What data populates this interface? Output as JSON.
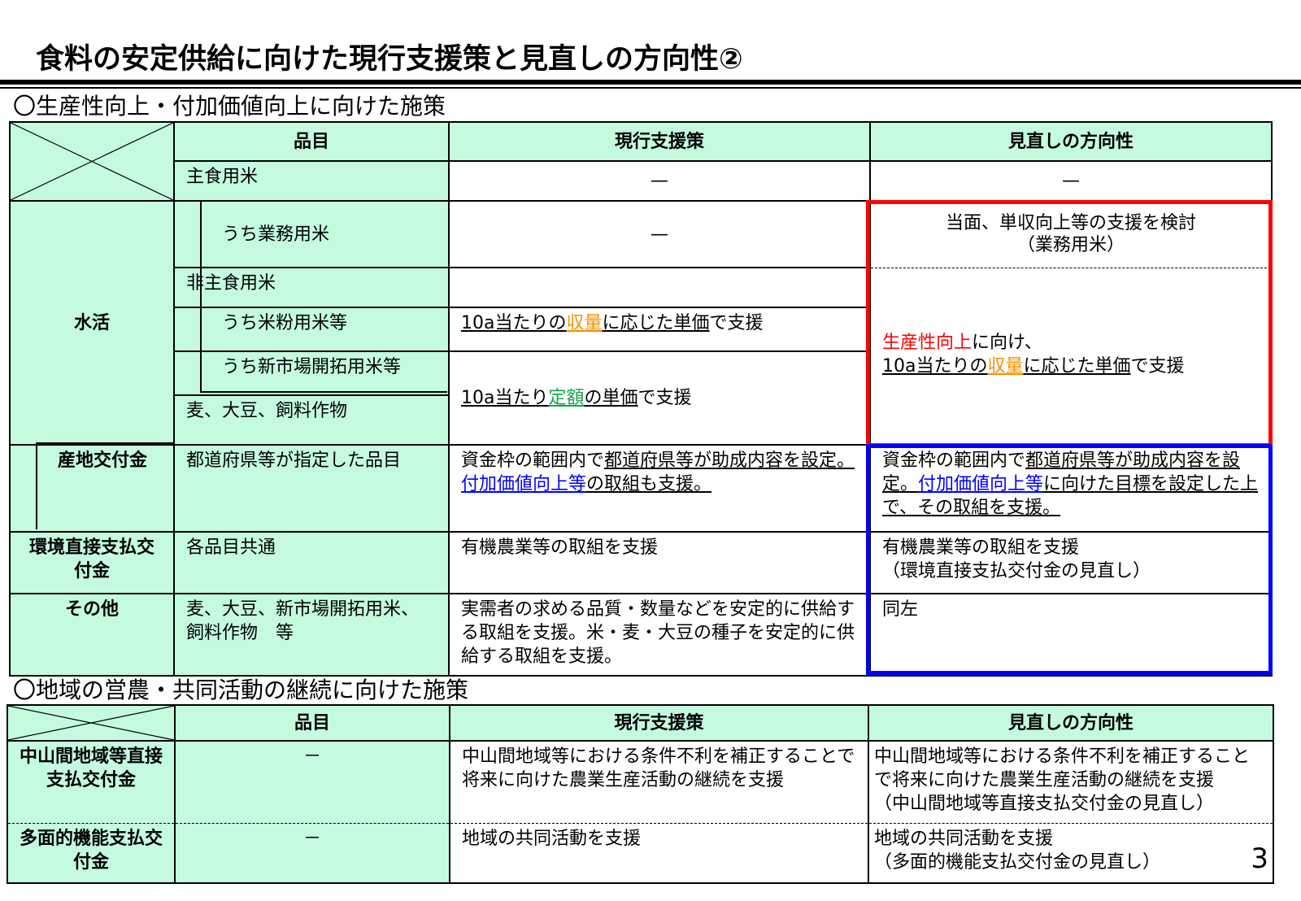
{
  "title": "食料の安定供給に向けた現行支援策と見直しの方向性②",
  "section1": {
    "heading": "〇生産性向上・付加価値向上に向けた施策",
    "col_item": "品目",
    "col_current": "現行支援策",
    "col_review": "見直しの方向性",
    "cat_suikatsu": "水活",
    "cat_sanchi": "産地交付金",
    "cat_kankyo": "環境直接支払交付金",
    "cat_sonota": "その他",
    "row_shushoku": {
      "item": "主食用米",
      "current": "—",
      "review": "—"
    },
    "row_gyomu": {
      "item": "うち業務用米",
      "current": "—",
      "review_1": "当面、単収向上等の支援を検討",
      "review_2": "（業務用米）"
    },
    "row_hishushoku": {
      "item": "非主食用米"
    },
    "row_komeko": {
      "item": "うち米粉用米等",
      "current_a": "10a当たりの",
      "current_b": "収量",
      "current_c": "に応じた単価",
      "current_d": "で支援"
    },
    "row_shinshijo": {
      "item": "うち新市場開拓用米等"
    },
    "row_mugi": {
      "item": "麦、大豆、飼料作物",
      "current_a": "10a当たり",
      "current_b": "定額",
      "current_c": "の単価",
      "current_d": "で支援"
    },
    "review_productivity": {
      "a": "生産性向上",
      "b": "に向け、",
      "c": "10a当たりの",
      "d": "収量",
      "e": "に応じた単価",
      "f": "で支援"
    },
    "row_sanchi": {
      "item": "都道府県等が指定した品目",
      "current_a": "資金枠の範囲内で",
      "current_b": "都道府県等が助成内容を設定。",
      "current_c": "付加価値向上等",
      "current_d": "の取組も支援。",
      "review_a": "資金枠の範囲内で",
      "review_b": "都道府県等が助成内容を設定。",
      "review_c": "付加価値向上等",
      "review_d": "に向けた目標を設定した上で、その取組を支援。"
    },
    "row_kankyo": {
      "item": "各品目共通",
      "current": "有機農業等の取組を支援",
      "review_1": "有機農業等の取組を支援",
      "review_2": "（環境直接支払交付金の見直し）"
    },
    "row_sonota": {
      "item_1": "麦、大豆、新市場開拓用米、",
      "item_2": "飼料作物　等",
      "current": "実需者の求める品質・数量などを安定的に供給する取組を支援。米・麦・大豆の種子を安定的に供給する取組を支援。",
      "review": "同左"
    }
  },
  "section2": {
    "heading": "〇地域の営農・共同活動の継続に向けた施策",
    "col_item": "品目",
    "col_current": "現行支援策",
    "col_review": "見直しの方向性",
    "row_chusankan": {
      "label": "中山間地域等直接支払交付金",
      "item": "－",
      "current": "中山間地域等における条件不利を補正することで将来に向けた農業生産活動の継続を支援",
      "review_1": "中山間地域等における条件不利を補正することで将来に向けた農業生産活動の継続を支援",
      "review_2": "（中山間地域等直接支払交付金の見直し）"
    },
    "row_tamenteki": {
      "label": "多面的機能支払交付金",
      "item": "－",
      "current": "地域の共同活動を支援",
      "review_1": "地域の共同活動を支援",
      "review_2": "（多面的機能支払交付金の見直し）"
    }
  },
  "page_number": "3",
  "colors": {
    "header_green": "#c4fbdf",
    "highlight_red": "#ff0000",
    "highlight_blue": "#0000ff",
    "orange": "#f29100",
    "green": "#1aa34a"
  }
}
